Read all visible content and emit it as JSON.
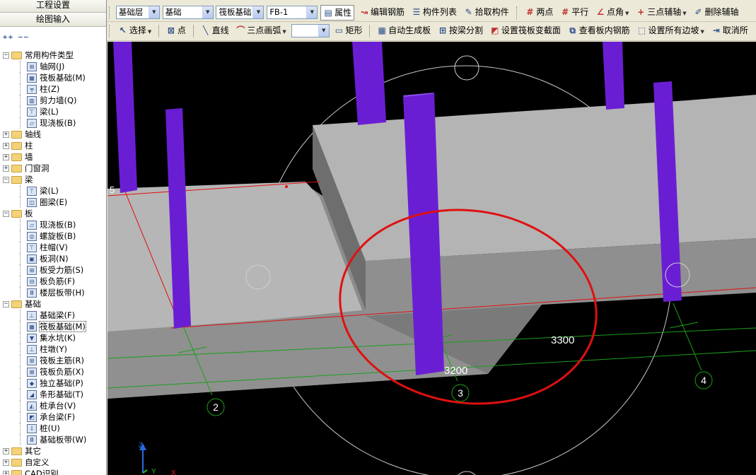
{
  "left_panel": {
    "tab_project": "工程设置",
    "tab_drawing": "绘图输入",
    "tree": [
      {
        "label": "常用构件类型",
        "level": 0,
        "exp": "−",
        "kind": "folder"
      },
      {
        "label": "轴网(J)",
        "level": 1,
        "kind": "item",
        "icon": "grid"
      },
      {
        "label": "筏板基础(M)",
        "level": 1,
        "kind": "item",
        "icon": "raft"
      },
      {
        "label": "柱(Z)",
        "level": 1,
        "kind": "item",
        "icon": "column"
      },
      {
        "label": "剪力墙(Q)",
        "level": 1,
        "kind": "item",
        "icon": "wall"
      },
      {
        "label": "梁(L)",
        "level": 1,
        "kind": "item",
        "icon": "beam"
      },
      {
        "label": "现浇板(B)",
        "level": 1,
        "kind": "item",
        "icon": "slab"
      },
      {
        "label": "轴线",
        "level": 0,
        "exp": "+",
        "kind": "folder"
      },
      {
        "label": "柱",
        "level": 0,
        "exp": "+",
        "kind": "folder"
      },
      {
        "label": "墙",
        "level": 0,
        "exp": "+",
        "kind": "folder"
      },
      {
        "label": "门窗洞",
        "level": 0,
        "exp": "+",
        "kind": "folder"
      },
      {
        "label": "梁",
        "level": 0,
        "exp": "−",
        "kind": "folder"
      },
      {
        "label": "梁(L)",
        "level": 1,
        "kind": "item",
        "icon": "beam"
      },
      {
        "label": "圈梁(E)",
        "level": 1,
        "kind": "item",
        "icon": "ring-beam"
      },
      {
        "label": "板",
        "level": 0,
        "exp": "−",
        "kind": "folder"
      },
      {
        "label": "现浇板(B)",
        "level": 1,
        "kind": "item",
        "icon": "slab"
      },
      {
        "label": "螺旋板(B)",
        "level": 1,
        "kind": "item",
        "icon": "spiral-slab"
      },
      {
        "label": "柱帽(V)",
        "level": 1,
        "kind": "item",
        "icon": "column-cap"
      },
      {
        "label": "板洞(N)",
        "level": 1,
        "kind": "item",
        "icon": "slab-hole"
      },
      {
        "label": "板受力筋(S)",
        "level": 1,
        "kind": "item",
        "icon": "slab-rebar"
      },
      {
        "label": "板负筋(F)",
        "level": 1,
        "kind": "item",
        "icon": "neg-rebar"
      },
      {
        "label": "楼层板带(H)",
        "level": 1,
        "kind": "item",
        "icon": "slab-strip"
      },
      {
        "label": "基础",
        "level": 0,
        "exp": "−",
        "kind": "folder"
      },
      {
        "label": "基础梁(F)",
        "level": 1,
        "kind": "item",
        "icon": "found-beam"
      },
      {
        "label": "筏板基础(M)",
        "level": 1,
        "kind": "item",
        "icon": "raft",
        "selected": true
      },
      {
        "label": "集水坑(K)",
        "level": 1,
        "kind": "item",
        "icon": "sump"
      },
      {
        "label": "柱墩(Y)",
        "level": 1,
        "kind": "item",
        "icon": "pier"
      },
      {
        "label": "筏板主筋(R)",
        "level": 1,
        "kind": "item",
        "icon": "raft-rebar"
      },
      {
        "label": "筏板负筋(X)",
        "level": 1,
        "kind": "item",
        "icon": "raft-neg"
      },
      {
        "label": "独立基础(P)",
        "level": 1,
        "kind": "item",
        "icon": "isolated"
      },
      {
        "label": "条形基础(T)",
        "level": 1,
        "kind": "item",
        "icon": "strip"
      },
      {
        "label": "桩承台(V)",
        "level": 1,
        "kind": "item",
        "icon": "pile-cap"
      },
      {
        "label": "承台梁(F)",
        "level": 1,
        "kind": "item",
        "icon": "cap-beam"
      },
      {
        "label": "桩(U)",
        "level": 1,
        "kind": "item",
        "icon": "pile"
      },
      {
        "label": "基础板带(W)",
        "level": 1,
        "kind": "item",
        "icon": "found-strip"
      },
      {
        "label": "其它",
        "level": 0,
        "exp": "+",
        "kind": "folder"
      },
      {
        "label": "自定义",
        "level": 0,
        "exp": "+",
        "kind": "folder"
      },
      {
        "label": "CAD识别",
        "level": 0,
        "exp": "+",
        "kind": "folder"
      }
    ]
  },
  "toolbar1": {
    "floor": "基础层",
    "category": "基础",
    "type": "筏板基础",
    "element": "FB-1",
    "properties": "属性",
    "edit_rebar": "编辑钢筋",
    "component_list": "构件列表",
    "pick_component": "拾取构件",
    "two_points": "两点",
    "parallel": "平行",
    "point_angle": "点角",
    "three_point_axis": "三点辅轴",
    "delete_axis": "删除辅轴"
  },
  "toolbar2": {
    "select": "选择",
    "point": "点",
    "line": "直线",
    "arc": "三点画弧",
    "arc_value": "",
    "rect": "矩形",
    "auto_slab": "自动生成板",
    "split_by_beam": "按梁分割",
    "set_section": "设置筏板变截面",
    "view_rebar": "查看板内钢筋",
    "set_slopes": "设置所有边坡",
    "cancel": "取消所"
  },
  "canvas": {
    "axis_2": "2",
    "axis_3": "3",
    "axis_4": "4",
    "dim_3300": "3300",
    "dim_3200": "3200",
    "label_5": "5",
    "axes_z": "Z",
    "axes_y": "Y",
    "axes_x": "X"
  },
  "colors": {
    "column": "#6a1ed4",
    "slab_top": "#b4b4b4",
    "highlight": "#e01010",
    "axis_line": "#1aa01a"
  }
}
